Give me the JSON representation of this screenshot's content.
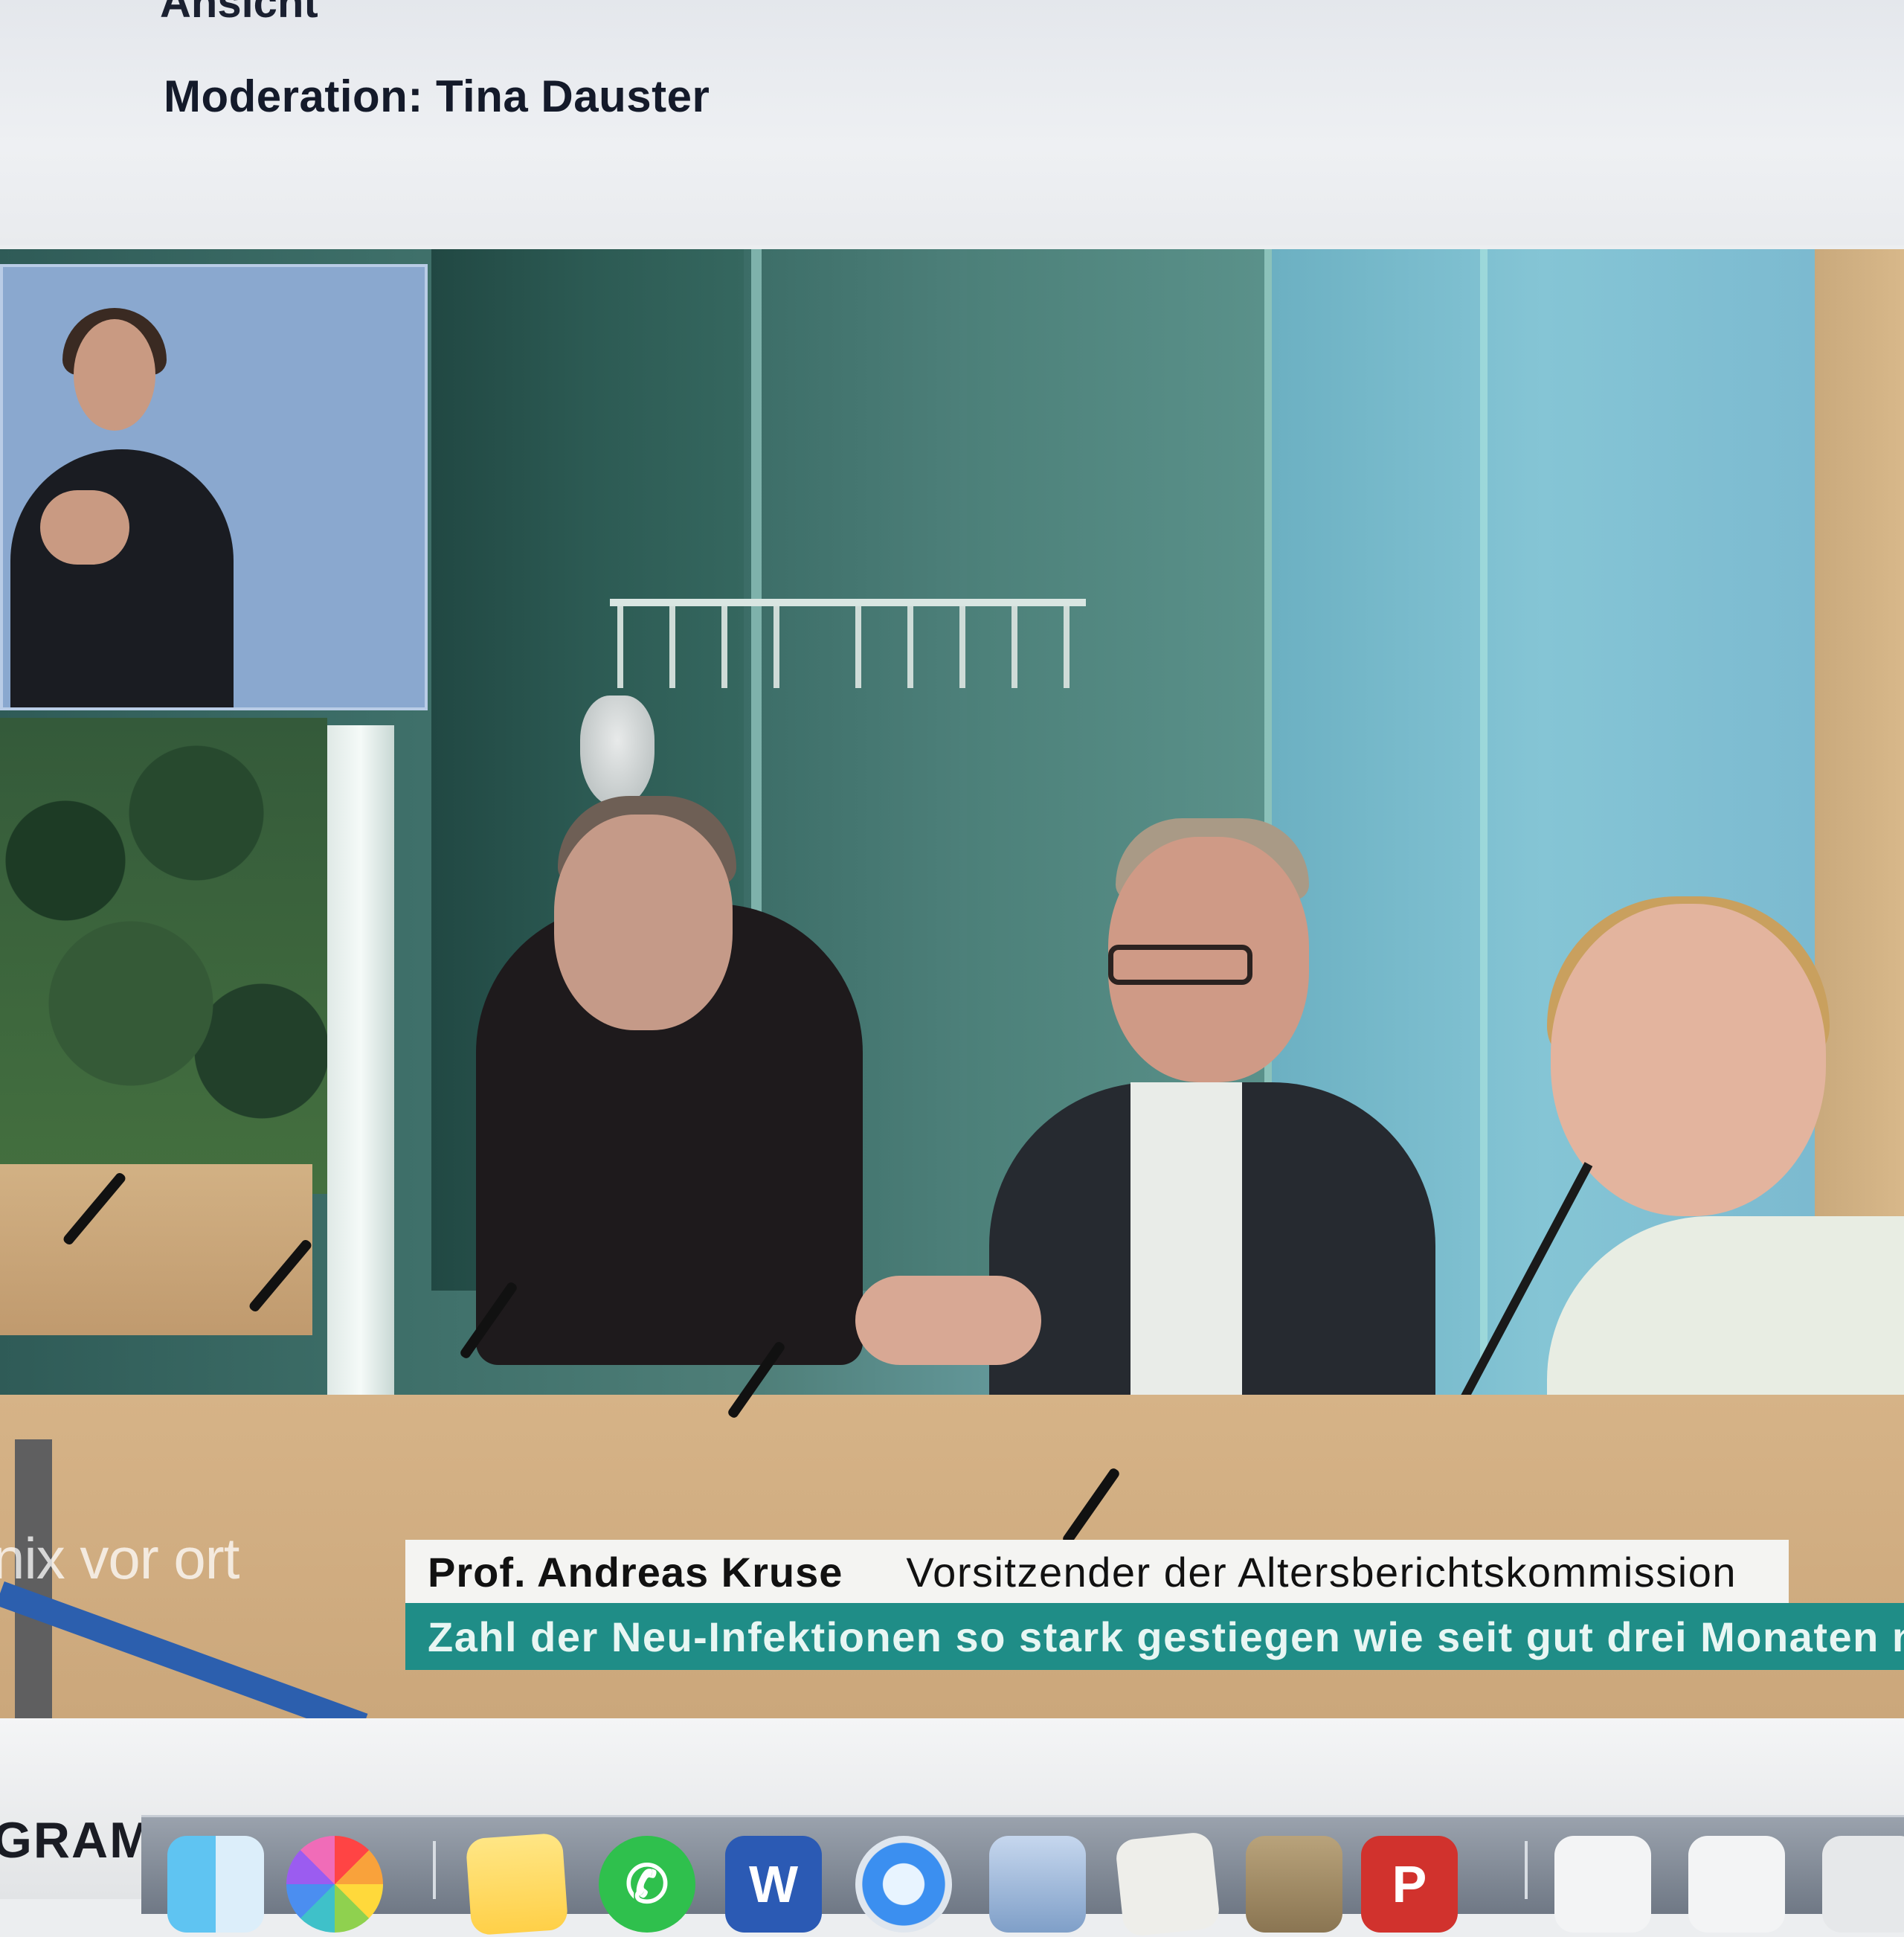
{
  "page": {
    "clipped_heading": "Ansicht",
    "moderation": "Moderation: Tina Dauster"
  },
  "video": {
    "channel_watermark": "nix vor ort",
    "lower_third": {
      "name": "Prof. Andreas Kruse",
      "role": "Vorsitzender der Altersberichtskommission"
    },
    "ticker": "Zahl der Neu-Infektionen so stark gestiegen wie seit gut drei Monaten ni"
  },
  "below": {
    "section_label": "GRAMM"
  },
  "dock": {
    "items": [
      {
        "icon": "finder-icon"
      },
      {
        "icon": "photos-icon"
      },
      {
        "icon": "stickies-icon"
      },
      {
        "icon": "whatsapp-icon"
      },
      {
        "icon": "word-icon",
        "glyph": "W"
      },
      {
        "icon": "safari-icon"
      },
      {
        "icon": "preview-icon"
      },
      {
        "icon": "pages-icon"
      },
      {
        "icon": "image-capture-icon"
      },
      {
        "icon": "powerpoint-icon",
        "glyph": "P"
      },
      {
        "icon": "document-icon"
      },
      {
        "icon": "document-icon"
      },
      {
        "icon": "document-icon"
      }
    ]
  }
}
